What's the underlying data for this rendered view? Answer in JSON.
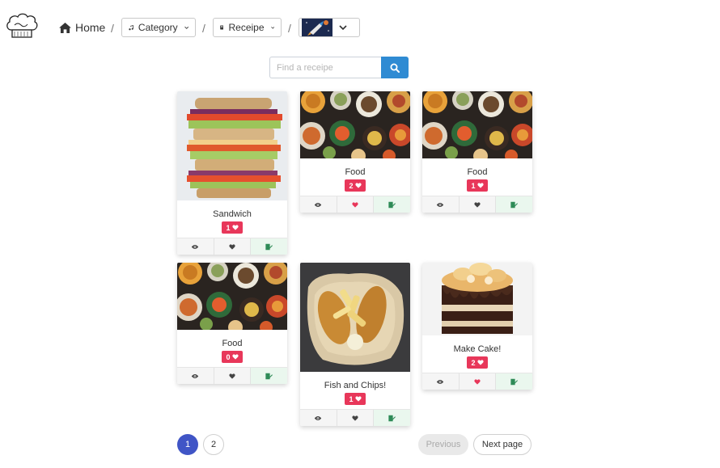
{
  "nav": {
    "home_label": "Home",
    "category_label": "Category",
    "receipe_label": "Receipe",
    "separator": "/"
  },
  "search": {
    "placeholder": "Find a receipe"
  },
  "cards": [
    {
      "title": "Sandwich",
      "likes": "1",
      "liked": false
    },
    {
      "title": "Food",
      "likes": "2",
      "liked": true
    },
    {
      "title": "Food",
      "likes": "1",
      "liked": false
    },
    {
      "title": "Food",
      "likes": "0",
      "liked": false
    },
    {
      "title": "Fish and Chips!",
      "likes": "1",
      "liked": false
    },
    {
      "title": "Make Cake!",
      "likes": "2",
      "liked": true
    }
  ],
  "pagination": {
    "pages": [
      "1",
      "2"
    ],
    "active_page": "1",
    "previous_label": "Previous",
    "next_label": "Next page"
  },
  "colors": {
    "accent_blue": "#2f8bd3",
    "like_badge": "#e8375a",
    "page_active": "#4055c6",
    "edit_icon": "#2e8b57"
  }
}
